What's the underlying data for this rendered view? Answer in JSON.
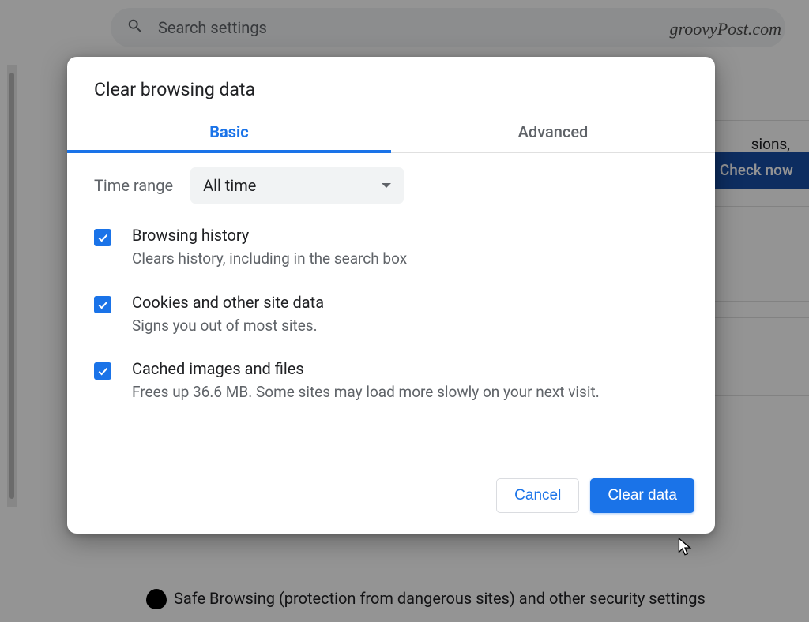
{
  "background": {
    "search_placeholder": "Search settings",
    "watermark": "groovyPost.com",
    "panel_text": "sions,",
    "check_btn": "Check now",
    "safe_browsing": "Safe Browsing (protection from dangerous sites) and other security settings"
  },
  "modal": {
    "title": "Clear browsing data",
    "tabs": {
      "basic": "Basic",
      "advanced": "Advanced"
    },
    "time_range_label": "Time range",
    "time_range_value": "All time",
    "options": [
      {
        "title": "Browsing history",
        "desc": "Clears history, including in the search box"
      },
      {
        "title": "Cookies and other site data",
        "desc": "Signs you out of most sites."
      },
      {
        "title": "Cached images and files",
        "desc": "Frees up 36.6 MB. Some sites may load more slowly on your next visit."
      }
    ],
    "buttons": {
      "cancel": "Cancel",
      "clear": "Clear data"
    }
  }
}
